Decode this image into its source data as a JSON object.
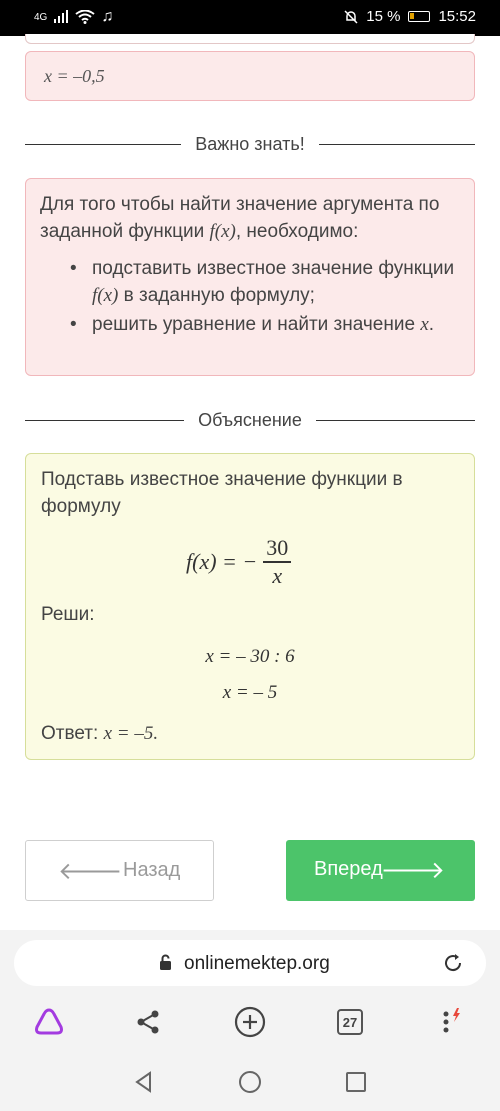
{
  "status_bar": {
    "network": "4G",
    "battery_percent": "15 %",
    "time": "15:52"
  },
  "previous_answer": "x = –0,5",
  "important": {
    "heading": "Важно знать!",
    "intro_part1": "Для того чтобы найти значение аргумента по заданной функции ",
    "intro_func": "f(x)",
    "intro_part2": ", необходимо:",
    "bullets": [
      {
        "part1": "подставить известное значение функции ",
        "func": "f(x)",
        "part2": " в заданную формулу;"
      },
      {
        "part1": "решить уравнение и найти значение ",
        "func": "x",
        "part2": "."
      }
    ]
  },
  "explanation": {
    "heading": "Объяснение",
    "text": "Подставь известное значение функции в формулу",
    "formula_lhs": "f(x) = −",
    "formula_num": "30",
    "formula_den": "x",
    "solve_label": "Реши:",
    "step1": "x = – 30 : 6",
    "step2": "x = – 5",
    "answer_label": "Ответ: ",
    "answer_value": "x = –5."
  },
  "buttons": {
    "back": "Назад",
    "next": "Вперед"
  },
  "browser": {
    "url": "onlinemektep.org",
    "tabs_count": "27"
  },
  "colors": {
    "next_button": "#4cc46a",
    "info_card_bg": "#fceaea",
    "explanation_card_bg": "#fbfbe3"
  }
}
